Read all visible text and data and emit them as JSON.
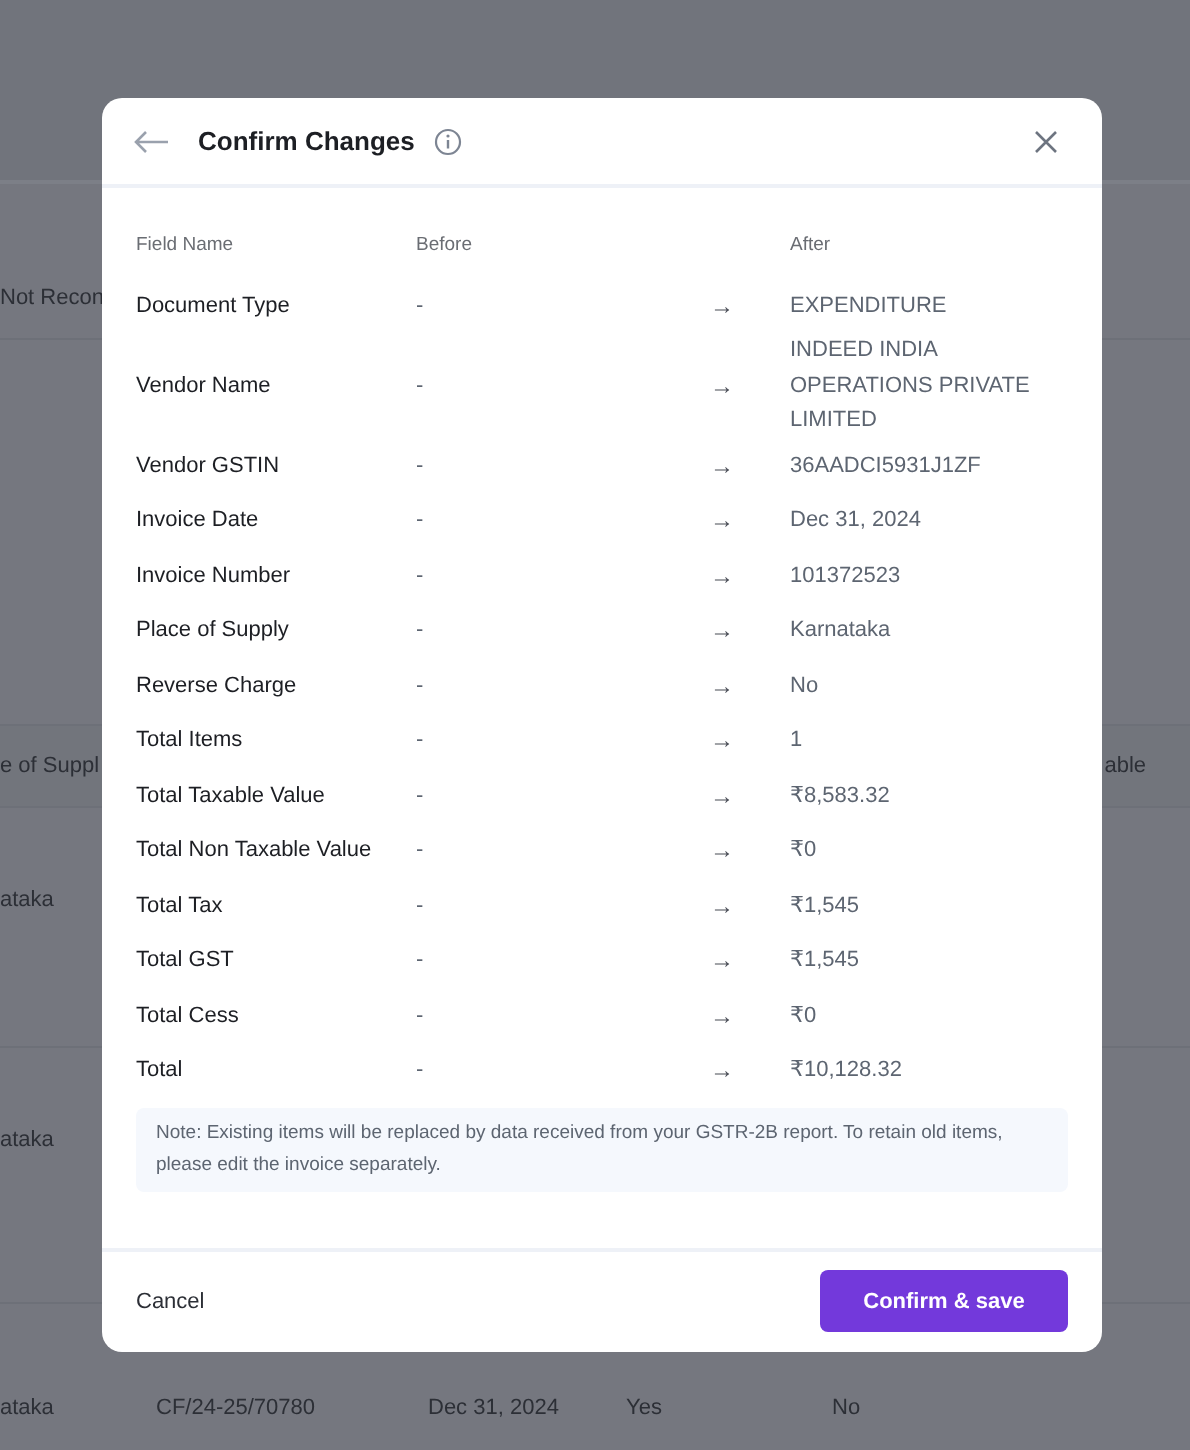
{
  "background": {
    "tab": "Not Recon",
    "columns": [
      "e of Suppl",
      "able"
    ],
    "rows": [
      {
        "column_1": "ataka"
      },
      {
        "column_1": "ataka"
      },
      {
        "column_1": "ataka",
        "column_2": "CF/24-25/70780",
        "column_3": "Dec 31, 2024",
        "column_4": "Yes",
        "column_5": "No"
      }
    ]
  },
  "dialog": {
    "title": "Confirm Changes",
    "columns": [
      "Field Name",
      "Before",
      "After"
    ],
    "rows": [
      {
        "field": "Document Type",
        "before": "-",
        "arrow": "→",
        "after": "EXPENDITURE"
      },
      {
        "field": "Vendor Name",
        "before": "-",
        "arrow": "→",
        "after": "INDEED INDIA OPERATIONS PRIVATE LIMITED"
      },
      {
        "field": "Vendor GSTIN",
        "before": "-",
        "arrow": "→",
        "after": "36AADCI5931J1ZF"
      },
      {
        "field": "Invoice Date",
        "before": "-",
        "arrow": "→",
        "after": "Dec 31, 2024"
      },
      {
        "field": "Invoice Number",
        "before": "-",
        "arrow": "→",
        "after": "101372523"
      },
      {
        "field": "Place of Supply",
        "before": "-",
        "arrow": "→",
        "after": "Karnataka"
      },
      {
        "field": "Reverse Charge",
        "before": "-",
        "arrow": "→",
        "after": "No"
      },
      {
        "field": "Total Items",
        "before": "-",
        "arrow": "→",
        "after": "1"
      },
      {
        "field": "Total Taxable Value",
        "before": "-",
        "arrow": "→",
        "after": "₹8,583.32"
      },
      {
        "field": "Total Non Taxable Value",
        "before": "-",
        "arrow": "→",
        "after": "₹0"
      },
      {
        "field": "Total Tax",
        "before": "-",
        "arrow": "→",
        "after": "₹1,545"
      },
      {
        "field": "Total GST",
        "before": "-",
        "arrow": "→",
        "after": "₹1,545"
      },
      {
        "field": "Total Cess",
        "before": "-",
        "arrow": "→",
        "after": "₹0"
      },
      {
        "field": "Total",
        "before": "-",
        "arrow": "→",
        "after": "₹10,128.32"
      }
    ],
    "note": "Note: Existing items will be replaced by data received from your GSTR-2B report. To retain old items, please edit the invoice separately.",
    "buttons": {
      "cancel": "Cancel",
      "confirm": "Confirm & save"
    }
  }
}
